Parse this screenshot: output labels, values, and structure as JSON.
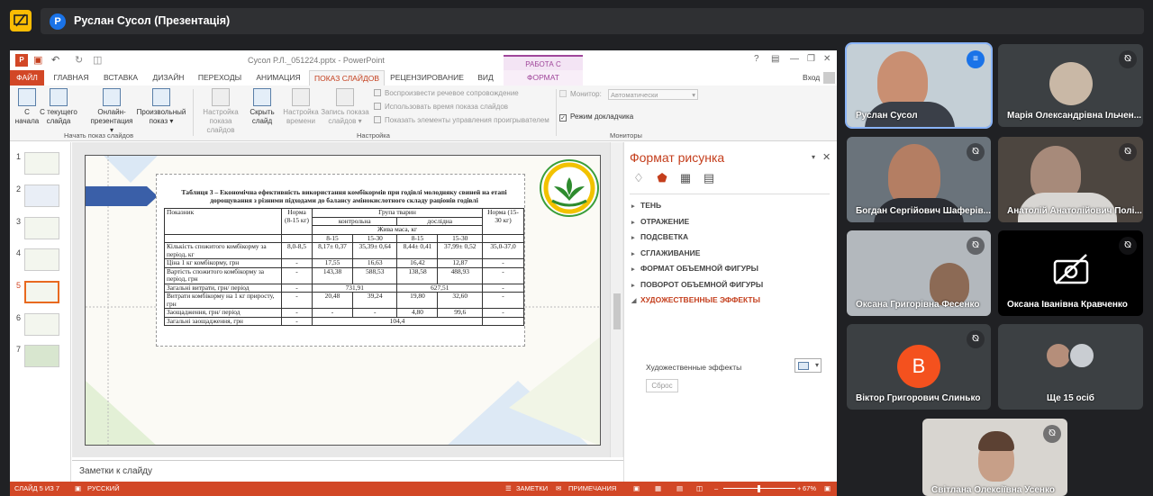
{
  "meet": {
    "title": "Руслан Сусол (Презентація)",
    "presenter_initial": "P"
  },
  "ppt": {
    "doc_title": "Сусол Р.Л._051224.pptx - PowerPoint",
    "context_group": "РАБОТА С РИСУНКАМИ",
    "sign_in": "Вход",
    "tabs": [
      "ФАЙЛ",
      "ГЛАВНАЯ",
      "ВСТАВКА",
      "ДИЗАЙН",
      "ПЕРЕХОДЫ",
      "АНИМАЦИЯ",
      "ПОКАЗ СЛАЙДОВ",
      "РЕЦЕНЗИРОВАНИЕ",
      "ВИД",
      "ФОРМАТ"
    ],
    "ribbon": {
      "from_start": [
        "С",
        "начала"
      ],
      "from_current": [
        "С текущего",
        "слайда"
      ],
      "online": [
        "Онлайн-",
        "презентация"
      ],
      "custom": [
        "Произвольный",
        "показ"
      ],
      "setup_show": [
        "Настройка",
        "показа слайдов"
      ],
      "hide_slide": [
        "Скрыть",
        "слайд"
      ],
      "rehearse": [
        "Настройка",
        "времени"
      ],
      "record": [
        "Запись показа",
        "слайдов"
      ],
      "chk_narration": "Воспроизвести речевое сопровождение",
      "chk_timings": "Использовать время показа слайдов",
      "chk_controls": "Показать элементы управления проигрывателем",
      "monitor_label": "Монитор:",
      "monitor_value": "Автоматически",
      "presenter_view": "Режим докладчика",
      "group_start": "Начать показ слайдов",
      "group_setup": "Настройка",
      "group_monitors": "Мониторы"
    },
    "thumbs": [
      "1",
      "2",
      "3",
      "4",
      "5",
      "6",
      "7"
    ],
    "selected_slide": 5,
    "notes_placeholder": "Заметки к слайду",
    "status": {
      "slide_info": "СЛАЙД 5 ИЗ 7",
      "language": "РУССКИЙ",
      "notes": "ЗАМЕТКИ",
      "comments": "ПРИМЕЧАНИЯ",
      "zoom": "67%"
    }
  },
  "slide": {
    "caption": "Таблиця 3 – Економічна ефективність використання комбікормів при годівлі молодняку свиней на етапі дорощування з різними підходами до балансу амінокислотного складу раціонів годівлі",
    "header": {
      "indicator": "Показник",
      "norm1": "Норма (8-15 кг)",
      "group": "Група тварин",
      "control": "контрольна",
      "experimental": "дослідна",
      "norm2": "Норма (15-30 кг)",
      "live_weight": "Жива маса, кг",
      "w1": "8-15",
      "w2": "15-30",
      "w3": "8-15",
      "w4": "15-30"
    },
    "rows": [
      [
        "Кількість спожитого комбікорму за період, кг",
        "8,0-8,5",
        "8,17± 0,37",
        "35,39± 0,64",
        "8,44± 0,41",
        "37,99± 0,52",
        "35,0-37,0"
      ],
      [
        "Ціна 1 кг комбікорму, грн",
        "-",
        "17,55",
        "16,63",
        "16,42",
        "12,87",
        "-"
      ],
      [
        "Вартість спожитого комбікорму за період, грн",
        "-",
        "143,38",
        "588,53",
        "138,58",
        "488,93",
        "-"
      ],
      [
        "Загальні витрати, грн/ період",
        "-",
        "731,91",
        "627,51",
        "-"
      ],
      [
        "Витрати комбікорму на 1 кг приросту, грн",
        "-",
        "20,48",
        "39,24",
        "19,80",
        "32,60",
        "-"
      ],
      [
        "Заощадження, грн/ період",
        "-",
        "-",
        "-",
        "4,80",
        "99,6",
        "-"
      ],
      [
        "Загальні заощадження, грн",
        "-",
        "104,4"
      ]
    ]
  },
  "pane": {
    "title": "Формат рисунка",
    "sections": [
      "ТЕНЬ",
      "ОТРАЖЕНИЕ",
      "ПОДСВЕТКА",
      "СГЛАЖИВАНИЕ",
      "ФОРМАТ ОБЪЕМНОЙ ФИГУРЫ",
      "ПОВОРОТ ОБЪЕМНОЙ ФИГУРЫ",
      "ХУДОЖЕСТВЕННЫЕ ЭФФЕКТЫ"
    ],
    "art_effects_label": "Художественные эффекты",
    "reset": "Сброс"
  },
  "participants": [
    {
      "name": "Руслан Сусол"
    },
    {
      "name": "Марія Олександрівна Ільчен..."
    },
    {
      "name": "Богдан Сергійович Шаферів..."
    },
    {
      "name": "Анатолій Анатолійович Полі..."
    },
    {
      "name": "Оксана Григорівна Фесенко"
    },
    {
      "name": "Оксана Іванівна Кравченко"
    },
    {
      "name": "Віктор Григорович Слинько",
      "initial": "В"
    },
    {
      "name": "Ще 15 осіб"
    },
    {
      "name": "Світлана Олексіївна Усенко"
    }
  ],
  "colors": {
    "meet_bg": "#202124",
    "ppt_accent": "#d24726",
    "format_accent": "#a0479b",
    "active_speaker": "#8ab4f8",
    "avatar_orange": "#f4511e"
  }
}
